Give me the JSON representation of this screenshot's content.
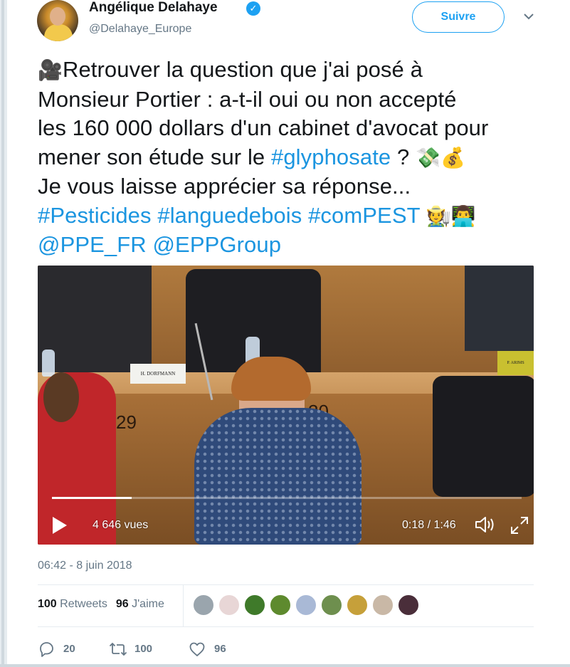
{
  "tweet": {
    "author_name": "Angélique Delahaye",
    "handle": "@Delahaye_Europe",
    "follow_label": "Suivre",
    "text_parts": {
      "line1": "Retrouver  la question que j'ai posé à",
      "line2": "Monsieur Portier : a-t-il oui ou non accepté",
      "line3": "les 160 000 dollars d'un cabinet d'avocat pour",
      "line4a": "mener son étude sur le ",
      "hashtag_glyphosate": "#glyphosate",
      "line4b": " ?",
      "line5": "Je vous laisse apprécier sa réponse...",
      "hashtag_pesticides": "#Pesticides",
      "hashtag_langue": "#languedebois",
      "hashtag_compest": "#comPEST",
      "mention_ppe": "@PPE_FR",
      "mention_epp": "@EPPGroup"
    },
    "emoji": {
      "camera": "🎥",
      "money_wings": "💸",
      "money_bag": "💰",
      "farmer": "🧑‍🌾",
      "technologist": "👨‍💻"
    },
    "timestamp": "06:42 - 8 juin 2018"
  },
  "video": {
    "views": "4 646 vues",
    "time": "0:18 / 1:46",
    "progress_fraction": 0.17,
    "nameplate_left": "H. DORFMANN",
    "nameplate_right": "P. ARIMS",
    "seat_left": "29",
    "seat_right": "30"
  },
  "stats": {
    "retweets_count": "100",
    "retweets_label": "Retweets",
    "likes_count": "96",
    "likes_label": "J'aime"
  },
  "likers": [
    {
      "name": "liker-1",
      "color": "#9aa5ad"
    },
    {
      "name": "liker-2",
      "color": "#e8d6d6"
    },
    {
      "name": "liker-3",
      "color": "#3f7a2a"
    },
    {
      "name": "liker-4",
      "color": "#5e8a2e"
    },
    {
      "name": "liker-5",
      "color": "#a9b9d6"
    },
    {
      "name": "liker-6",
      "color": "#6e8f4e"
    },
    {
      "name": "liker-7",
      "color": "#c6a03a"
    },
    {
      "name": "liker-8",
      "color": "#c9b8a6"
    },
    {
      "name": "liker-9",
      "color": "#4a2e3a"
    }
  ],
  "actions": {
    "reply_count": "20",
    "retweet_count": "100",
    "like_count": "96"
  },
  "colors": {
    "link": "#1b95e0",
    "accent": "#1da1f2",
    "muted": "#657786"
  }
}
